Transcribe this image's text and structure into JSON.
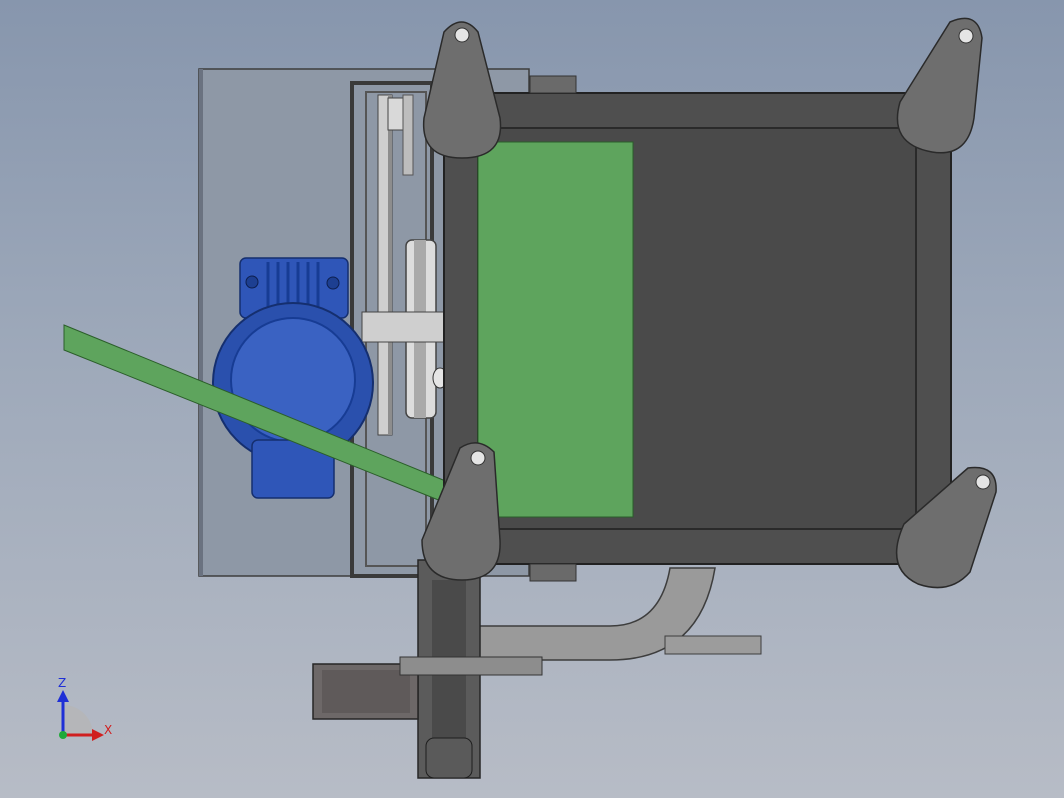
{
  "viewport": {
    "background_top": "#8796ad",
    "background_bottom": "#b7bcc6"
  },
  "model": {
    "motor_color": "#2f56b8",
    "panel_color": "#5ea45d",
    "frame_color": "#4f4f4f",
    "lug_color": "#6e6e6e"
  },
  "triad": {
    "z_label": "Z",
    "x_label": "X",
    "z_color": "#1f2fd6",
    "x_color": "#d01f1f",
    "y_color": "#1faa3a"
  }
}
